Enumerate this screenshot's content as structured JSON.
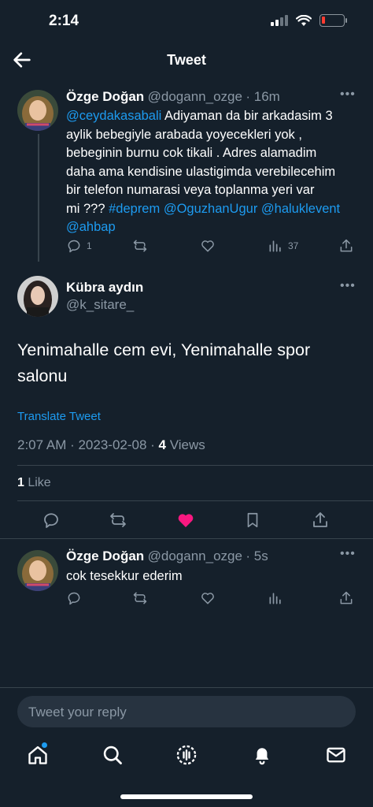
{
  "status": {
    "time": "2:14"
  },
  "header": {
    "title": "Tweet"
  },
  "parent_tweet": {
    "name": "Özge Doğan",
    "handle": "@dogann_ozge",
    "time": "· 16m",
    "mention": "@ceydakasabali",
    "text_line1_rest": " Adiyaman da bir arkadasim 3",
    "text_lines": [
      "aylik bebegiyle arabada yoyecekleri yok ,",
      "bebeginin burnu cok tikali . Adres alamadim",
      "daha ama kendisine ulastigimda verebilecehim",
      "bir telefon numarasi veya toplanma yeri var"
    ],
    "text_last_prefix": "mi ??? ",
    "tags": [
      "#deprem",
      "@OguzhanUgur",
      "@haluklevent",
      "@ahbap"
    ],
    "reply_count": "1",
    "view_count": "37"
  },
  "main_tweet": {
    "name": "Kübra aydın",
    "handle": "@k_sitare_",
    "text": "Yenimahalle cem evi, Yenimahalle spor salonu",
    "translate": "Translate Tweet",
    "timestamp": "2:07 AM · 2023-02-08 · ",
    "views_count": "4",
    "views_label": " Views",
    "likes_count": "1",
    "likes_label": " Like"
  },
  "reply_tweet": {
    "name": "Özge Doğan",
    "handle": "@dogann_ozge",
    "time": "· 5s",
    "text": "cok tesekkur ederim"
  },
  "compose": {
    "placeholder": "Tweet your reply"
  },
  "colors": {
    "background": "#15202b",
    "accent": "#1d9bf0",
    "like": "#f91880",
    "muted": "#8b98a5"
  }
}
